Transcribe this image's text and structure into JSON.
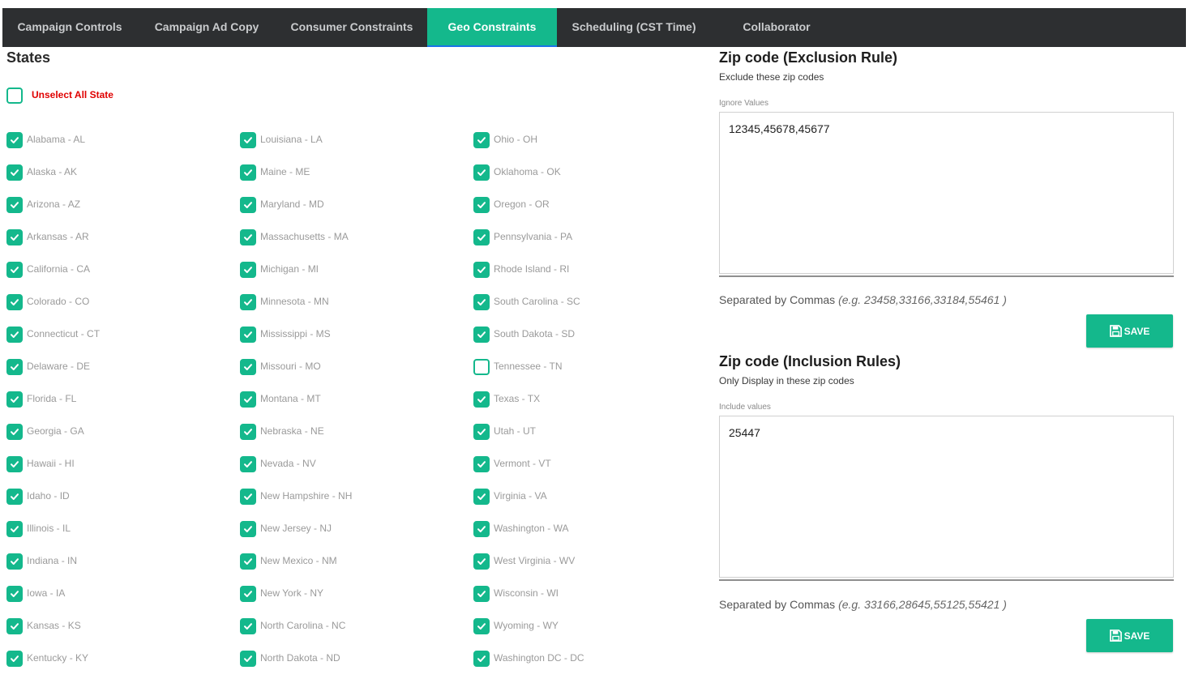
{
  "colors": {
    "accent": "#14b88c",
    "tabbar": "#2d2f31",
    "warning": "#e00000"
  },
  "tabs": [
    {
      "label": "Campaign Controls",
      "active": false
    },
    {
      "label": "Campaign Ad Copy",
      "active": false
    },
    {
      "label": "Consumer Constraints",
      "active": false
    },
    {
      "label": "Geo Constraints",
      "active": true
    },
    {
      "label": "Scheduling (CST Time)",
      "active": false
    },
    {
      "label": "Collaborator",
      "active": false
    }
  ],
  "states": {
    "title": "States",
    "unselect_all_label": "Unselect All State",
    "unselect_all_checked": false,
    "columns": [
      [
        {
          "label": "Alabama - AL",
          "checked": true
        },
        {
          "label": "Alaska - AK",
          "checked": true
        },
        {
          "label": "Arizona - AZ",
          "checked": true
        },
        {
          "label": "Arkansas - AR",
          "checked": true
        },
        {
          "label": "California - CA",
          "checked": true
        },
        {
          "label": "Colorado - CO",
          "checked": true
        },
        {
          "label": "Connecticut - CT",
          "checked": true
        },
        {
          "label": "Delaware - DE",
          "checked": true
        },
        {
          "label": "Florida - FL",
          "checked": true
        },
        {
          "label": "Georgia - GA",
          "checked": true
        },
        {
          "label": "Hawaii - HI",
          "checked": true
        },
        {
          "label": "Idaho - ID",
          "checked": true
        },
        {
          "label": "Illinois - IL",
          "checked": true
        },
        {
          "label": "Indiana - IN",
          "checked": true
        },
        {
          "label": "Iowa - IA",
          "checked": true
        },
        {
          "label": "Kansas - KS",
          "checked": true
        },
        {
          "label": "Kentucky - KY",
          "checked": true
        }
      ],
      [
        {
          "label": "Louisiana - LA",
          "checked": true
        },
        {
          "label": "Maine - ME",
          "checked": true
        },
        {
          "label": "Maryland - MD",
          "checked": true
        },
        {
          "label": "Massachusetts - MA",
          "checked": true
        },
        {
          "label": "Michigan - MI",
          "checked": true
        },
        {
          "label": "Minnesota - MN",
          "checked": true
        },
        {
          "label": "Mississippi - MS",
          "checked": true
        },
        {
          "label": "Missouri - MO",
          "checked": true
        },
        {
          "label": "Montana - MT",
          "checked": true
        },
        {
          "label": "Nebraska - NE",
          "checked": true
        },
        {
          "label": "Nevada - NV",
          "checked": true
        },
        {
          "label": "New Hampshire - NH",
          "checked": true
        },
        {
          "label": "New Jersey - NJ",
          "checked": true
        },
        {
          "label": "New Mexico - NM",
          "checked": true
        },
        {
          "label": "New York - NY",
          "checked": true
        },
        {
          "label": "North Carolina - NC",
          "checked": true
        },
        {
          "label": "North Dakota - ND",
          "checked": true
        }
      ],
      [
        {
          "label": "Ohio - OH",
          "checked": true
        },
        {
          "label": "Oklahoma - OK",
          "checked": true
        },
        {
          "label": "Oregon - OR",
          "checked": true
        },
        {
          "label": "Pennsylvania - PA",
          "checked": true
        },
        {
          "label": "Rhode Island - RI",
          "checked": true
        },
        {
          "label": "South Carolina - SC",
          "checked": true
        },
        {
          "label": "South Dakota - SD",
          "checked": true
        },
        {
          "label": "Tennessee - TN",
          "checked": false
        },
        {
          "label": "Texas - TX",
          "checked": true
        },
        {
          "label": "Utah - UT",
          "checked": true
        },
        {
          "label": "Vermont - VT",
          "checked": true
        },
        {
          "label": "Virginia - VA",
          "checked": true
        },
        {
          "label": "Washington - WA",
          "checked": true
        },
        {
          "label": "West Virginia - WV",
          "checked": true
        },
        {
          "label": "Wisconsin - WI",
          "checked": true
        },
        {
          "label": "Wyoming - WY",
          "checked": true
        },
        {
          "label": "Washington DC - DC",
          "checked": true
        }
      ]
    ]
  },
  "exclusion": {
    "title": "Zip code (Exclusion Rule)",
    "subtitle": "Exclude these zip codes",
    "field_label": "Ignore Values",
    "value": "12345,45678,45677",
    "hint": "Separated by Commas",
    "hint_example": "(e.g. 23458,33166,33184,55461 )",
    "save_label": "SAVE",
    "save_icon": "floppy-disk-icon"
  },
  "inclusion": {
    "title": "Zip code (Inclusion Rules)",
    "subtitle": "Only Display in these zip codes",
    "field_label": "Include values",
    "value": "25447",
    "hint": "Separated by Commas",
    "hint_example": "(e.g. 33166,28645,55125,55421 )",
    "save_label": "SAVE",
    "save_icon": "floppy-disk-icon"
  }
}
